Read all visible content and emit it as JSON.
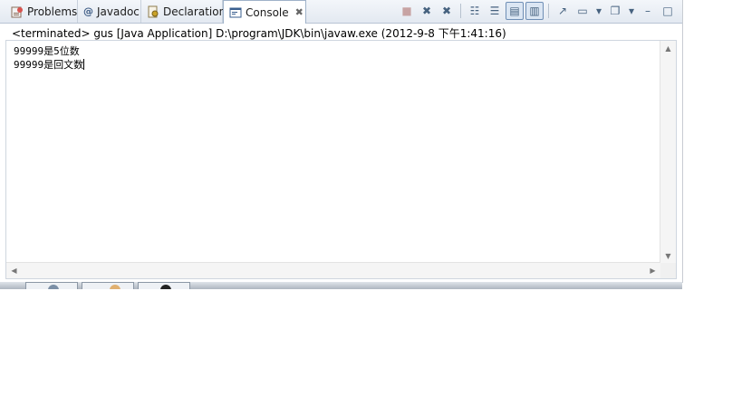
{
  "tabs": [
    {
      "label": "Problems",
      "icon": "problems-icon",
      "active": false
    },
    {
      "label": "Javadoc",
      "icon": "at-sign-icon",
      "active": false
    },
    {
      "label": "Declaration",
      "icon": "declaration-icon",
      "active": false
    },
    {
      "label": "Console",
      "icon": "console-icon",
      "active": true,
      "close_glyph": "✖"
    }
  ],
  "toolbar": {
    "buttons": [
      {
        "name": "terminate-icon",
        "glyph": "■",
        "state": "disabled"
      },
      {
        "name": "remove-launch-icon",
        "glyph": "✖",
        "state": "normal"
      },
      {
        "name": "remove-all-terminated-icon",
        "glyph": "✖",
        "state": "normal"
      },
      {
        "name": "clear-console-icon",
        "glyph": "☷",
        "state": "normal"
      },
      {
        "name": "scroll-lock-icon",
        "glyph": "☰",
        "state": "normal"
      },
      {
        "name": "show-on-stdout-icon",
        "glyph": "▤",
        "state": "pressed"
      },
      {
        "name": "show-on-stderr-icon",
        "glyph": "▥",
        "state": "pressed"
      },
      {
        "name": "pin-console-icon",
        "glyph": "↗",
        "state": "normal"
      },
      {
        "name": "display-console-icon",
        "glyph": "▭",
        "state": "normal"
      },
      {
        "name": "display-console-dropdown-icon",
        "glyph": "▾",
        "state": "normal"
      },
      {
        "name": "open-console-icon",
        "glyph": "❐",
        "state": "normal"
      },
      {
        "name": "open-console-dropdown-icon",
        "glyph": "▾",
        "state": "normal"
      },
      {
        "name": "minimize-icon",
        "glyph": "–",
        "state": "normal"
      },
      {
        "name": "maximize-icon",
        "glyph": "□",
        "state": "normal"
      }
    ]
  },
  "console": {
    "status": "<terminated> gus [Java Application] D:\\program\\JDK\\bin\\javaw.exe (2012-9-8 下午1:41:16)",
    "lines": [
      "99999是5位数",
      "99999是回文数"
    ]
  },
  "colors": {
    "tab_bar": "#e3e9f1",
    "active_tab": "#ffffff",
    "accent": "#46627f"
  }
}
